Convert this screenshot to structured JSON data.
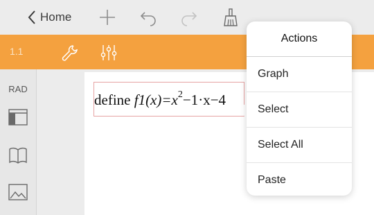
{
  "topbar": {
    "home_label": "Home"
  },
  "orangebar": {
    "page_number": "1.1"
  },
  "rail": {
    "angle_mode": "RAD"
  },
  "editor": {
    "define_keyword": "define",
    "expression_prefix": "f1(x)=x",
    "exponent": "2",
    "expression_rest": "−1·x−4"
  },
  "actions_menu": {
    "title": "Actions",
    "items": [
      {
        "label": "Graph"
      },
      {
        "label": "Select"
      },
      {
        "label": "Select All"
      },
      {
        "label": "Paste"
      }
    ]
  },
  "colors": {
    "accent": "#f4a13f",
    "toolbar": "#ececec",
    "selection_border": "#e6a3a3"
  }
}
